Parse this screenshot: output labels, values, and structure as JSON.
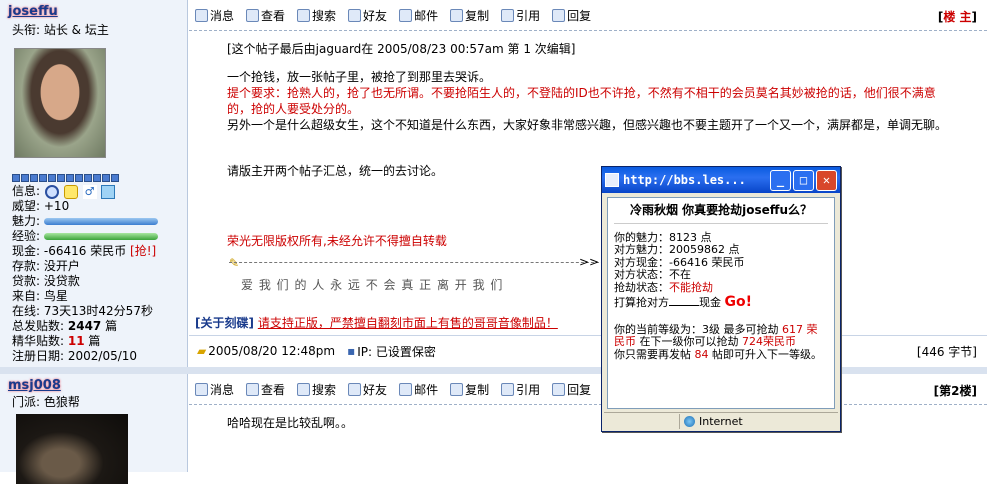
{
  "post1": {
    "username": "joseffu",
    "title": "头衔: 站长 & 坛主",
    "info": {
      "label_info": "信息:",
      "label_prestige": "威望:",
      "prestige": "+10",
      "label_charm": "魅力:",
      "label_exp": "经验:",
      "label_cash": "现金:",
      "cash": "-66416 荣民币",
      "rob": "[抢!]",
      "label_deposit": "存款:",
      "deposit": "没开户",
      "label_loan": "贷款:",
      "loan": "没贷款",
      "label_from": "来自:",
      "from": "鸟星",
      "label_online": "在线:",
      "online": "73天13时42分57秒",
      "label_posts": "总发贴数:",
      "posts": "2447",
      "posts_unit": "篇",
      "label_elite": "精华贴数:",
      "elite": "11",
      "elite_unit": "篇",
      "label_reg": "注册日期:",
      "reg": "2002/05/10"
    },
    "floor_open": "[",
    "floor": "楼 主",
    "floor_close": "]",
    "edited": "[这个帖子最后由jaguard在 2005/08/23 00:57am 第 1 次编辑]",
    "line1": "一个抢钱，放一张帖子里，被抢了到那里去哭诉。",
    "line2": "提个要求：抢熟人的，抢了也无所谓。不要抢陌生人的，不登陆的ID也不许抢，不然有不相干的会员莫名其妙被抢的话，他们很不满意",
    "line3": "的，抢的人要受处分的。",
    "line4": "另外一个是什么超级女生，这个不知道是什么东西，大家好象非常感兴趣，但感兴趣也不要主题开了一个又一个，满屏都是，单调无聊。",
    "line5": "请版主开两个帖子汇总，统一的去讨论。",
    "copyright": "荣光无限版权所有,未经允许不得擅自转载",
    "sig_arrow": ">>",
    "signature": "爱 我 们 的 人 永 远 不 会 真 正 离 开 我 们",
    "about_label": "[关于刻碟]",
    "about_link": "请支持正版，严禁擅自翻刻市面上有售的哥哥音像制品！",
    "date": "2005/08/20 12:48pm",
    "ip_label": "IP: 已设置保密",
    "bytes": "[446 字节]"
  },
  "toolbar": {
    "msg": "消息",
    "view": "查看",
    "search": "搜索",
    "friend": "好友",
    "mail": "邮件",
    "copy": "复制",
    "quote": "引用",
    "reply": "回复"
  },
  "post2": {
    "username": "msj008",
    "sect": "门派: 色狼帮",
    "floor": "[第2楼]",
    "text": "哈哈现在是比较乱啊。。"
  },
  "popup": {
    "title": "http://bbs.les...",
    "heading": "冷雨秋烟  你真要抢劫joseffu么？",
    "my_charm": "你的魅力：8123 点",
    "their_charm": "对方魅力：20059862 点",
    "their_cash": "对方现金：-66416 荣民币",
    "their_state": "对方状态：不在",
    "rob_state_label": "抢劫状态：",
    "rob_state": "不能抢劫",
    "rob_prefix": "打算抢对方",
    "rob_suffix": "现金",
    "go": "Go!",
    "level_text": "你的当前等级为：3级 最多可抢劫 ",
    "level_amount": "617 荣民币",
    "next_text": " 在下一级你可以抢劫 ",
    "next_amount": "724荣民币",
    "need_text": "你只需要再发帖 ",
    "need_num": "84",
    "need_suffix": " 帖即可升入下一等级。",
    "status": "Internet"
  }
}
